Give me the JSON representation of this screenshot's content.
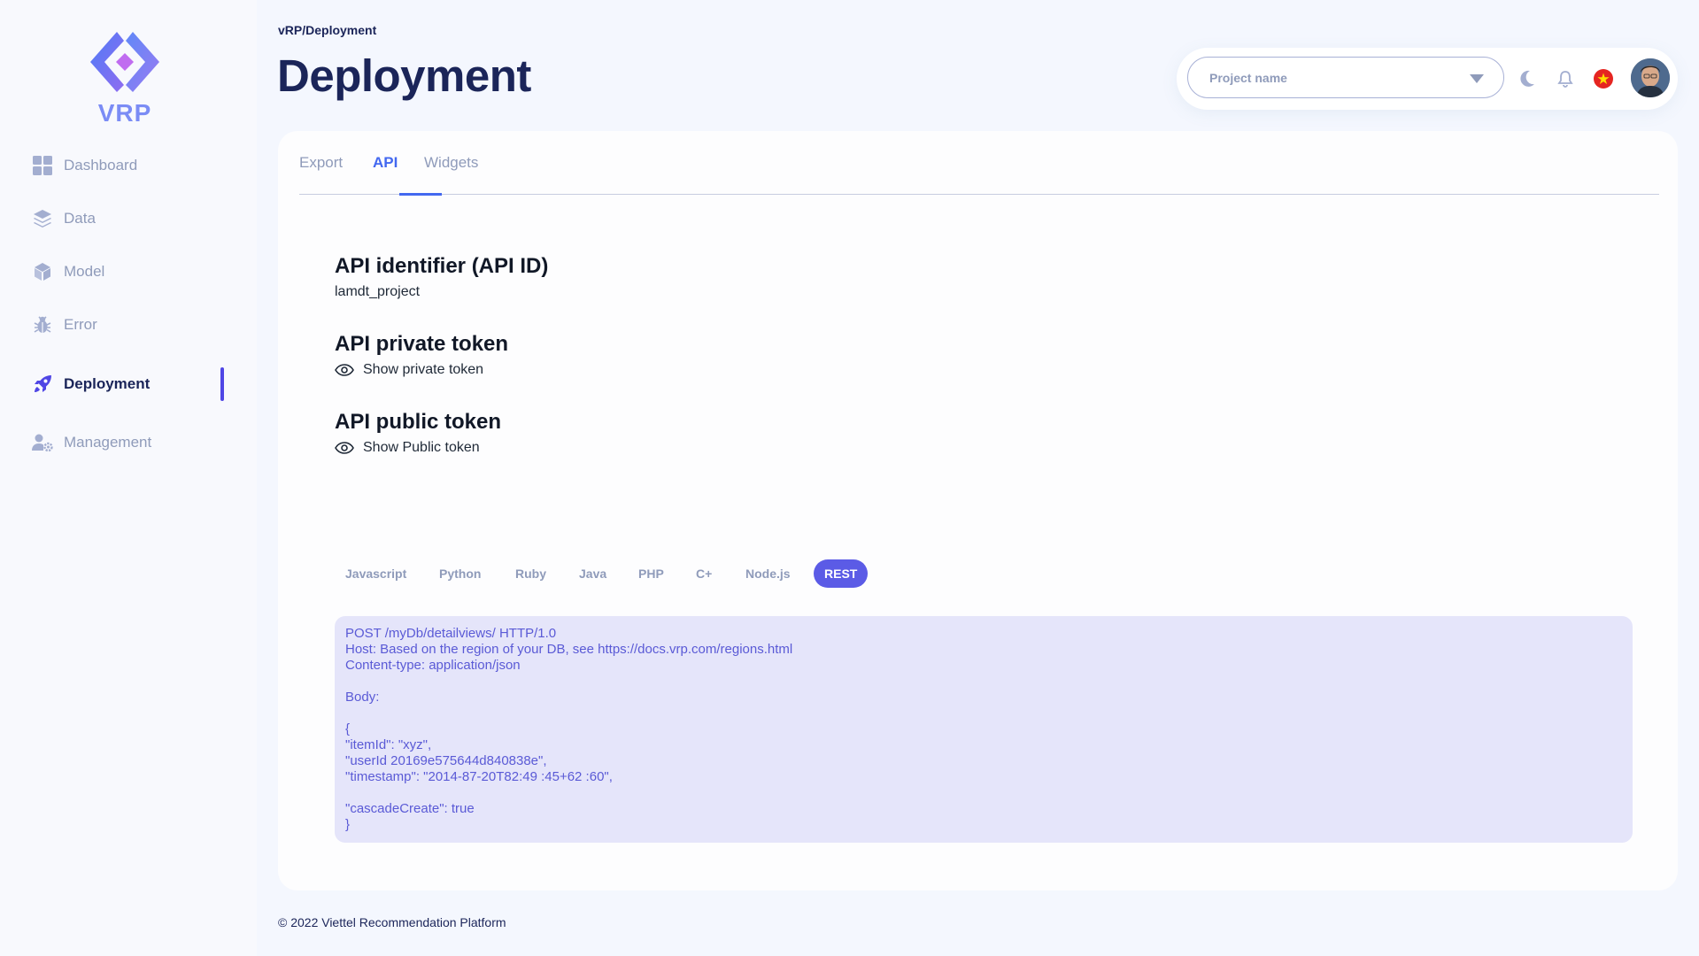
{
  "app": {
    "logo_text": "VRP"
  },
  "sidebar": {
    "items": [
      {
        "label": "Dashboard",
        "icon": "dashboard-icon"
      },
      {
        "label": "Data",
        "icon": "layers-icon"
      },
      {
        "label": "Model",
        "icon": "cube-icon"
      },
      {
        "label": "Error",
        "icon": "bug-icon"
      },
      {
        "label": "Deployment",
        "icon": "rocket-icon",
        "active": true
      },
      {
        "label": "Management",
        "icon": "user-gear-icon"
      }
    ]
  },
  "header": {
    "breadcrumb": "vRP/Deployment",
    "title": "Deployment",
    "project_select": {
      "placeholder": "Project name"
    },
    "icons": [
      "moon-icon",
      "bell-icon",
      "vietnam-flag-icon",
      "avatar"
    ]
  },
  "tabs": [
    {
      "label": "Export"
    },
    {
      "label": "API",
      "active": true
    },
    {
      "label": "Widgets"
    }
  ],
  "api": {
    "identifier": {
      "title": "API identifier (API ID)",
      "value": "lamdt_project"
    },
    "private_token": {
      "title": "API private token",
      "action": "Show private token"
    },
    "public_token": {
      "title": "API public token",
      "action": "Show Public token"
    }
  },
  "languages": [
    "Javascript",
    "Python",
    "Ruby",
    "Java",
    "PHP",
    "C+",
    "Node.js",
    "REST"
  ],
  "selected_language": "REST",
  "code_sample": "POST /myDb/detailviews/ HTTP/1.0\nHost: Based on the region of your DB, see https://docs.vrp.com/regions.html\nContent-type: application/json\n\nBody:\n\n{\n\"itemId\": \"xyz\",\n\"userId 20169e575644d840838e\",\n\"timestamp\": \"2014-87-20T82:49 :45+62 :60\",\n\n\"cascadeCreate\": true\n}",
  "footer": "© 2022 Viettel Recommendation Platform",
  "colors": {
    "accent": "#4368f0",
    "active_pill": "#5b5be6",
    "code_bg": "#e5e5fa",
    "code_text": "#5a5ad6",
    "muted": "#8f9bba"
  }
}
